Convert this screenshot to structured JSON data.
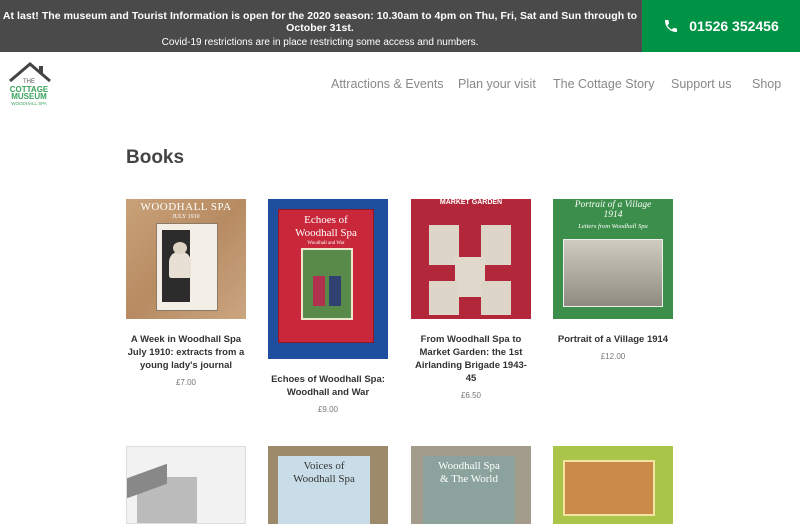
{
  "announcement": {
    "line1": "At last! The museum and Tourist Information is open for the 2020 season: 10.30am to 4pm on Thu, Fri, Sat and Sun through to October 31st.",
    "line2": "Covid-19 restrictions are in place restricting some access and numbers."
  },
  "phone": {
    "number": "01526 352456",
    "icon": "phone-icon"
  },
  "logo": {
    "line1": "THE",
    "line2": "COTTAGE",
    "line3": "MUSEUM",
    "line4": "WOODHALL SPA"
  },
  "nav": {
    "items": [
      "Attractions & Events",
      "Plan your visit",
      "The Cottage Story",
      "Support us",
      "Shop"
    ]
  },
  "page": {
    "title": "Books"
  },
  "products": [
    {
      "title": "A Week in Woodhall Spa July 1910: extracts from a young lady's journal",
      "price": "£7.00",
      "cover_text": [
        "WOODHALL SPA",
        "JULY 1910"
      ]
    },
    {
      "title": "Echoes of Woodhall Spa: Woodhall and War",
      "price": "£9.00",
      "cover_text": [
        "Echoes of",
        "Woodhall Spa",
        "Woodhall and War"
      ]
    },
    {
      "title": "From Woodhall Spa to Market Garden: the 1st Airlanding Brigade 1943-45",
      "price": "£6.50",
      "cover_text": [
        "MARKET GARDEN"
      ]
    },
    {
      "title": "Portrait of a Village 1914",
      "price": "£12.00",
      "cover_text": [
        "Portrait of a Village",
        "1914",
        "Letters from Woodhall Spa"
      ]
    }
  ],
  "products_row2": [
    {
      "cover_text": []
    },
    {
      "cover_text": [
        "Voices of",
        "Woodhall Spa"
      ]
    },
    {
      "cover_text": [
        "Woodhall Spa",
        "& The World"
      ]
    },
    {
      "cover_text": []
    }
  ],
  "colors": {
    "topbar": "#4a4a4a",
    "phone_bg": "#009345",
    "brand_green": "#3aa35c"
  }
}
